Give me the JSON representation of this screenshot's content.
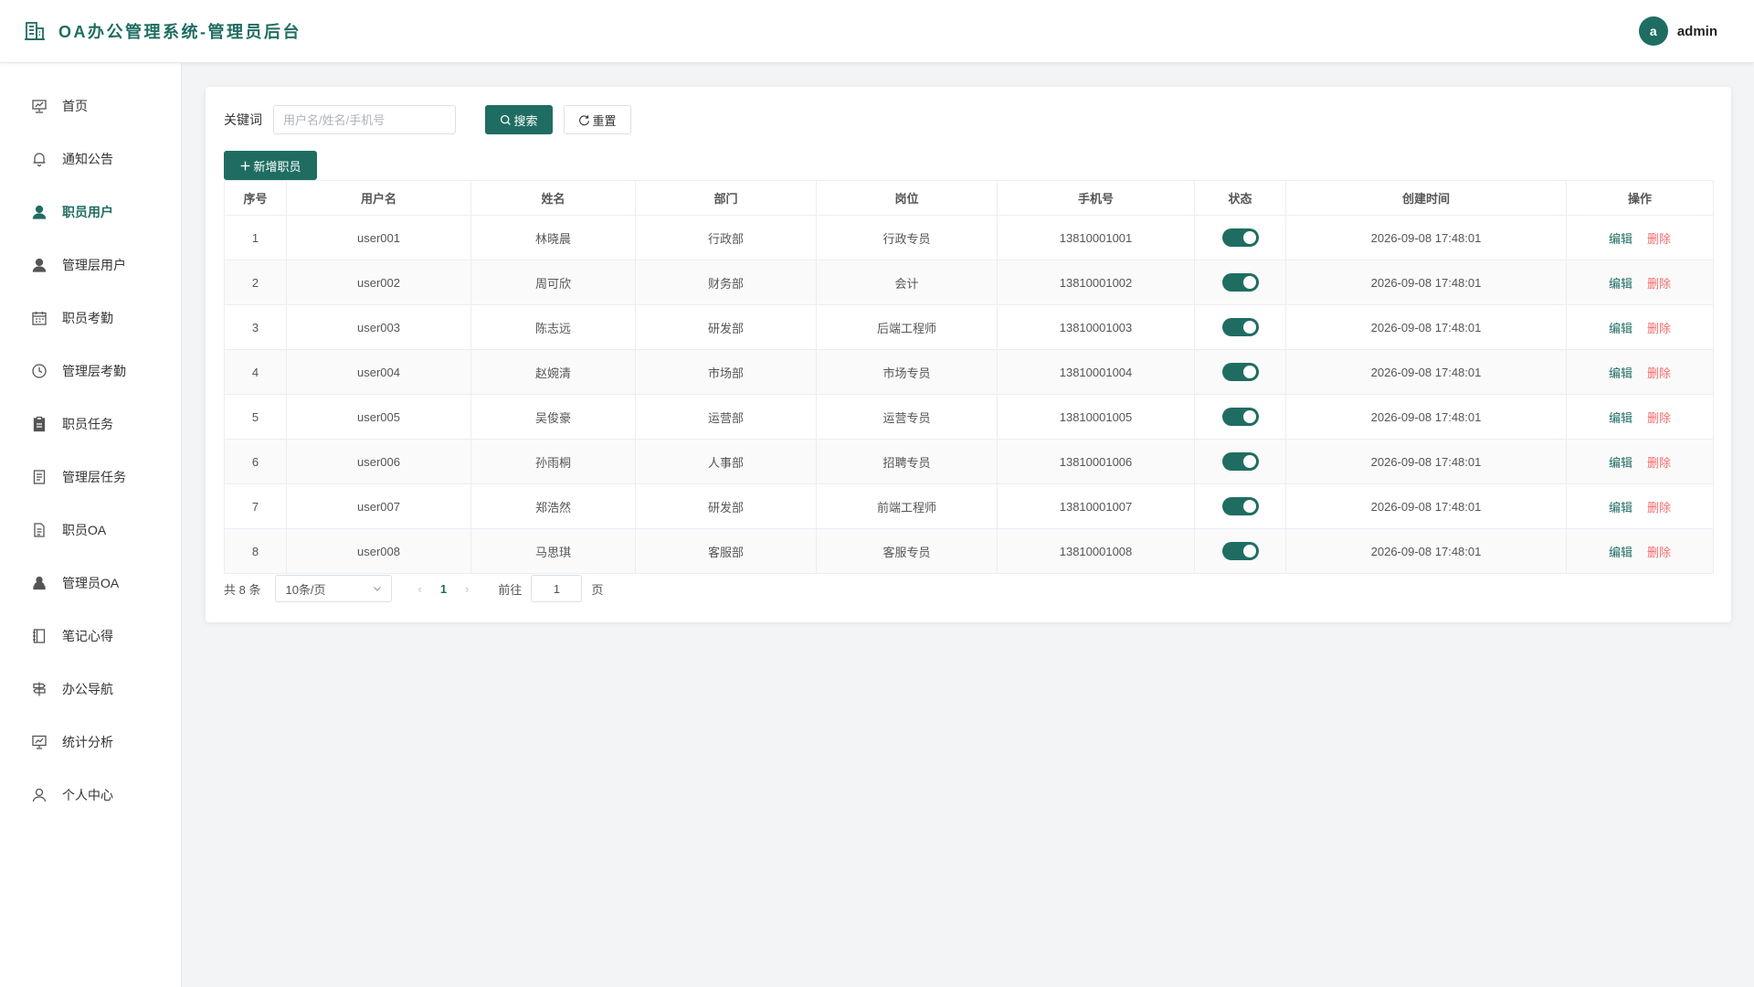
{
  "app": {
    "title": "OA办公管理系统-管理员后台",
    "brand_color": "#1f6d62",
    "logo_icon": "building-icon"
  },
  "user": {
    "avatar_letter": "a",
    "name": "admin"
  },
  "sidebar": {
    "items": [
      {
        "label": "首页",
        "icon": "presentation-icon",
        "active": false
      },
      {
        "label": "通知公告",
        "icon": "bell-icon",
        "active": false
      },
      {
        "label": "职员用户",
        "icon": "user-icon",
        "active": true
      },
      {
        "label": "管理层用户",
        "icon": "user-icon",
        "active": false
      },
      {
        "label": "职员考勤",
        "icon": "calendar-icon",
        "active": false
      },
      {
        "label": "管理层考勤",
        "icon": "clock-icon",
        "active": false
      },
      {
        "label": "职员任务",
        "icon": "clipboard-icon",
        "active": false
      },
      {
        "label": "管理层任务",
        "icon": "document-icon",
        "active": false
      },
      {
        "label": "职员OA",
        "icon": "file-icon",
        "active": false
      },
      {
        "label": "管理员OA",
        "icon": "user-stamp-icon",
        "active": false
      },
      {
        "label": "笔记心得",
        "icon": "notebook-icon",
        "active": false
      },
      {
        "label": "办公导航",
        "icon": "signpost-icon",
        "active": false
      },
      {
        "label": "统计分析",
        "icon": "chart-board-icon",
        "active": false
      },
      {
        "label": "个人中心",
        "icon": "person-outline-icon",
        "active": false
      }
    ]
  },
  "search": {
    "label": "关键词",
    "placeholder": "用户名/姓名/手机号",
    "value": "",
    "search_button": "搜索",
    "reset_button": "重置"
  },
  "toolbar": {
    "add_button": "新增职员"
  },
  "table": {
    "headers": [
      "序号",
      "用户名",
      "姓名",
      "部门",
      "岗位",
      "手机号",
      "状态",
      "创建时间",
      "操作"
    ],
    "rows": [
      {
        "index": "1",
        "username": "user001",
        "name": "林晓晨",
        "dept": "行政部",
        "position": "行政专员",
        "phone": "13810001001",
        "status": true,
        "created": "2026-09-08 17:48:01"
      },
      {
        "index": "2",
        "username": "user002",
        "name": "周可欣",
        "dept": "财务部",
        "position": "会计",
        "phone": "13810001002",
        "status": true,
        "created": "2026-09-08 17:48:01"
      },
      {
        "index": "3",
        "username": "user003",
        "name": "陈志远",
        "dept": "研发部",
        "position": "后端工程师",
        "phone": "13810001003",
        "status": true,
        "created": "2026-09-08 17:48:01"
      },
      {
        "index": "4",
        "username": "user004",
        "name": "赵婉清",
        "dept": "市场部",
        "position": "市场专员",
        "phone": "13810001004",
        "status": true,
        "created": "2026-09-08 17:48:01"
      },
      {
        "index": "5",
        "username": "user005",
        "name": "吴俊豪",
        "dept": "运营部",
        "position": "运营专员",
        "phone": "13810001005",
        "status": true,
        "created": "2026-09-08 17:48:01"
      },
      {
        "index": "6",
        "username": "user006",
        "name": "孙雨桐",
        "dept": "人事部",
        "position": "招聘专员",
        "phone": "13810001006",
        "status": true,
        "created": "2026-09-08 17:48:01"
      },
      {
        "index": "7",
        "username": "user007",
        "name": "郑浩然",
        "dept": "研发部",
        "position": "前端工程师",
        "phone": "13810001007",
        "status": true,
        "created": "2026-09-08 17:48:01"
      },
      {
        "index": "8",
        "username": "user008",
        "name": "马思琪",
        "dept": "客服部",
        "position": "客服专员",
        "phone": "13810001008",
        "status": true,
        "created": "2026-09-08 17:48:01"
      }
    ],
    "edit_label": "编辑",
    "delete_label": "删除"
  },
  "pagination": {
    "total_text": "共 8 条",
    "page_size": "10条/页",
    "current_page": "1",
    "goto_label": "前往",
    "goto_value": "1",
    "page_suffix": "页"
  }
}
